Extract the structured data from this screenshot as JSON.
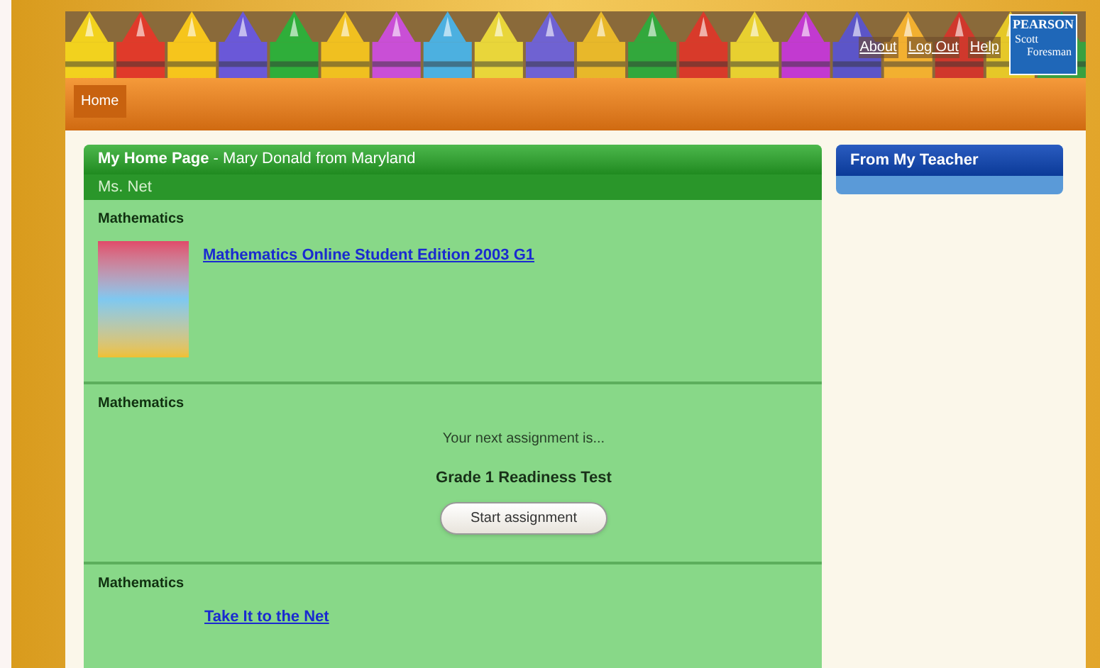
{
  "header": {
    "links": [
      "About",
      "Log Out",
      "Help"
    ],
    "logo": {
      "brand": "PEARSON",
      "sub_1": "Scott",
      "sub_2": "Foresman"
    }
  },
  "nav": {
    "tabs": [
      {
        "label": "Home",
        "selected": true
      }
    ]
  },
  "main": {
    "title": "**My Home Page** - Mary Donald from Maryland",
    "teacher": "Ms. Net",
    "sections": [
      {
        "kind": "book",
        "subject": "Mathematics",
        "link": "Mathematics Online Student Edition 2003 G1"
      },
      {
        "kind": "assignment",
        "subject": "Mathematics",
        "intro": "Your next assignment is...",
        "assignment": "Grade 1 Readiness Test",
        "button": "Start assignment"
      },
      {
        "kind": "link",
        "subject": "Mathematics",
        "link": "Take It to the Net"
      }
    ]
  },
  "side": {
    "title": "From My Teacher"
  }
}
